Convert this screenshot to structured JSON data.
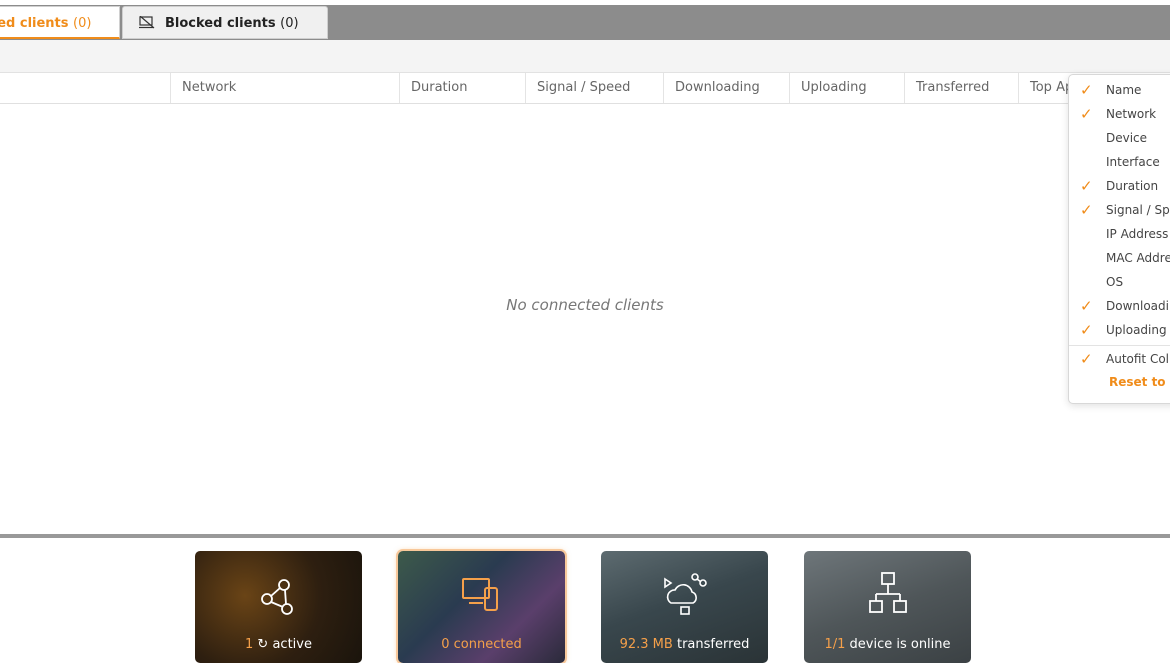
{
  "tabs": {
    "active": {
      "label": "ted clients",
      "count": "(0)"
    },
    "blocked": {
      "label": "Blocked clients",
      "count": "(0)",
      "icon": "blocked-device-icon"
    }
  },
  "columns": [
    "Network",
    "Duration",
    "Signal / Speed",
    "Downloading",
    "Uploading",
    "Transferred",
    "Top Ap"
  ],
  "empty_message": "No connected clients",
  "menu": {
    "items": [
      {
        "label": "Name",
        "checked": true
      },
      {
        "label": "Network",
        "checked": true
      },
      {
        "label": "Device",
        "checked": false
      },
      {
        "label": "Interface",
        "checked": false
      },
      {
        "label": "Duration",
        "checked": true
      },
      {
        "label": "Signal / Spe",
        "checked": true
      },
      {
        "label": "IP Address",
        "checked": false
      },
      {
        "label": "MAC Addres",
        "checked": false
      },
      {
        "label": "OS",
        "checked": false
      },
      {
        "label": "Downloadin",
        "checked": true
      },
      {
        "label": "Uploading",
        "checked": true
      }
    ],
    "autofit": {
      "label": "Autofit Colu",
      "checked": true
    },
    "reset_label": "Reset to d",
    "check_glyph": "✓"
  },
  "cards": [
    {
      "value": "1",
      "suffix": "active",
      "icon": "network-icon"
    },
    {
      "value": "0 connected",
      "suffix": "",
      "icon": "devices-icon"
    },
    {
      "value": "92.3 MB",
      "suffix": "transferred",
      "icon": "cloud-share-icon"
    },
    {
      "value": "1/1",
      "suffix": "device is online",
      "icon": "topology-icon"
    }
  ],
  "colors": {
    "accent": "#f08c1a"
  }
}
